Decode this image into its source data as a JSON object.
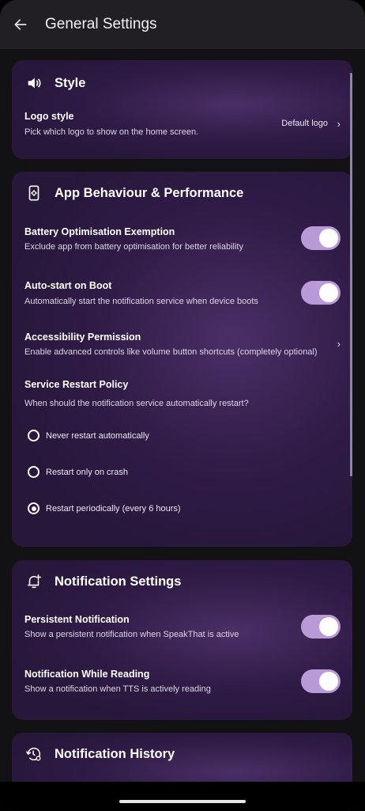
{
  "header": {
    "title": "General Settings",
    "back_icon": "arrow-left-icon"
  },
  "style_card": {
    "title": "Style",
    "icon": "speaker-icon",
    "logo_style": {
      "title": "Logo style",
      "subtitle": "Pick which logo to show on the home screen.",
      "value": "Default logo",
      "chevron": "›"
    }
  },
  "behaviour_card": {
    "title": "App Behaviour & Performance",
    "icon": "phone-gear-icon",
    "battery": {
      "title": "Battery Optimisation Exemption",
      "subtitle": "Exclude app from battery optimisation for better reliability",
      "enabled": true
    },
    "autostart": {
      "title": "Auto-start on Boot",
      "subtitle": "Automatically start the notification service when device boots",
      "enabled": true
    },
    "accessibility": {
      "title": "Accessibility Permission",
      "subtitle": "Enable advanced controls like volume button shortcuts (completely optional)",
      "chevron": "›"
    },
    "restart_policy": {
      "title": "Service Restart Policy",
      "subtitle": "When should the notification service automatically restart?",
      "options": [
        {
          "label": "Never restart automatically",
          "selected": false
        },
        {
          "label": "Restart only on crash",
          "selected": false
        },
        {
          "label": "Restart periodically (every 6 hours)",
          "selected": true
        }
      ]
    }
  },
  "notification_card": {
    "title": "Notification Settings",
    "icon": "bell-plus-icon",
    "persistent": {
      "title": "Persistent Notification",
      "subtitle": "Show a persistent notification when SpeakThat is active",
      "enabled": true
    },
    "while_reading": {
      "title": "Notification While Reading",
      "subtitle": "Show a notification when TTS is actively reading",
      "enabled": true
    }
  },
  "history_card": {
    "title": "Notification History",
    "icon": "history-gear-icon"
  },
  "colors": {
    "accent": "#b89ad6",
    "card": "#2f1b46",
    "background": "#121114"
  }
}
